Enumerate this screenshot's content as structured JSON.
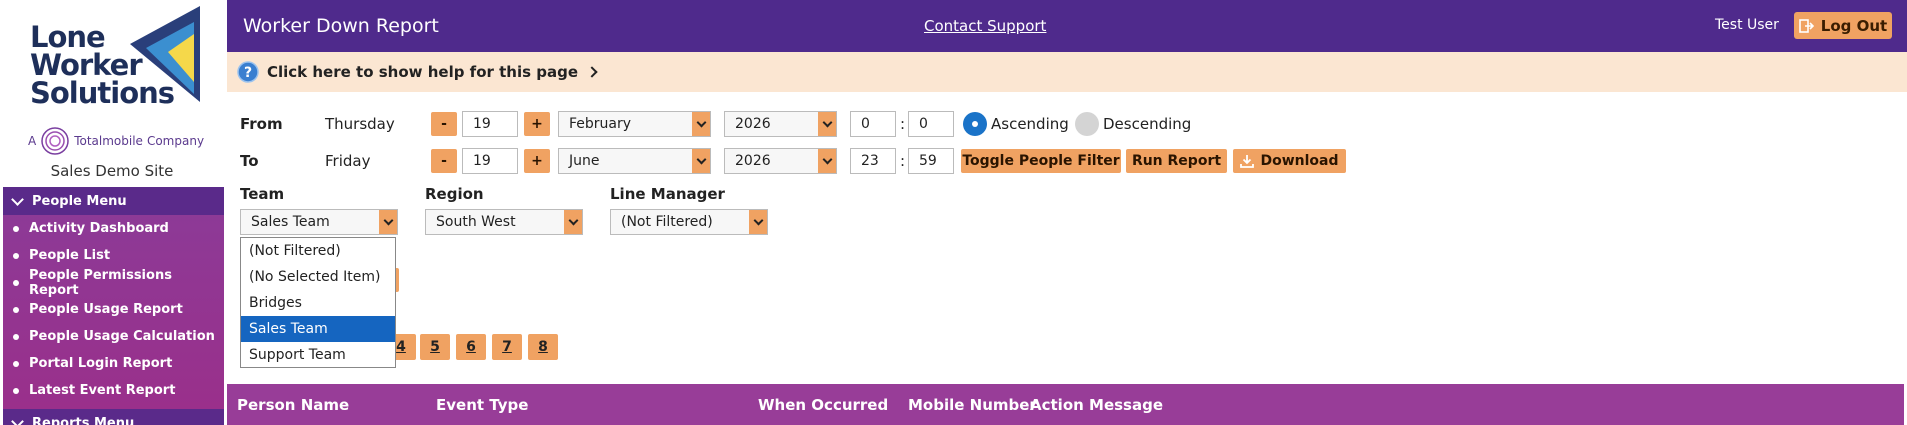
{
  "sidebar": {
    "logo_words": [
      "Lone",
      "Worker",
      "Solutions"
    ],
    "company_prefix": "A",
    "company_name": "Totalmobile",
    "company_suffix": "Company",
    "site_name": "Sales Demo Site",
    "people_menu_label": "People Menu",
    "items": [
      {
        "label": "Activity Dashboard"
      },
      {
        "label": "People List"
      },
      {
        "label": "People Permissions Report"
      },
      {
        "label": "People Usage Report"
      },
      {
        "label": "People Usage Calculation"
      },
      {
        "label": "Portal Login Report"
      },
      {
        "label": "Latest Event Report"
      }
    ],
    "reports_menu_label": "Reports Menu"
  },
  "header": {
    "title": "Worker Down Report",
    "contact_support": "Contact Support",
    "user": "Test User",
    "logout_label": "Log Out"
  },
  "help": {
    "text": "Click here to show help for this page"
  },
  "filters": {
    "from_label": "From",
    "from_day": "Thursday",
    "from_date": "19",
    "from_month": "February",
    "from_year": "2026",
    "from_hour": "0",
    "from_minute": "0",
    "to_label": "To",
    "to_day": "Friday",
    "to_date": "19",
    "to_month": "June",
    "to_year": "2026",
    "to_hour": "23",
    "to_minute": "59",
    "minus": "-",
    "plus": "+",
    "colon": ":",
    "ascending": "Ascending",
    "descending": "Descending",
    "toggle_people_filter": "Toggle People Filter",
    "run_report": "Run Report",
    "download": "Download",
    "team_label": "Team",
    "team_value": "Sales Team",
    "region_label": "Region",
    "region_value": "South West",
    "line_manager_label": "Line Manager",
    "line_manager_value": "(Not Filtered)"
  },
  "team_dropdown": {
    "options": [
      "(Not Filtered)",
      "(No Selected Item)",
      "Bridges",
      "Sales Team",
      "Support Team"
    ],
    "selected": "Sales Team"
  },
  "pagination": {
    "pages": [
      "4",
      "5",
      "6",
      "7",
      "8"
    ]
  },
  "table": {
    "columns": [
      "Person Name",
      "Event Type",
      "When Occurred",
      "Mobile Number",
      "Action Message"
    ]
  },
  "colors": {
    "header_purple": "#4f2a8c",
    "sidebar_purple": "#8b3b98",
    "accent_orange": "#f0a262",
    "help_bg": "#fbe6d2",
    "table_head": "#983d98",
    "radio_selected": "#1a73c8"
  }
}
